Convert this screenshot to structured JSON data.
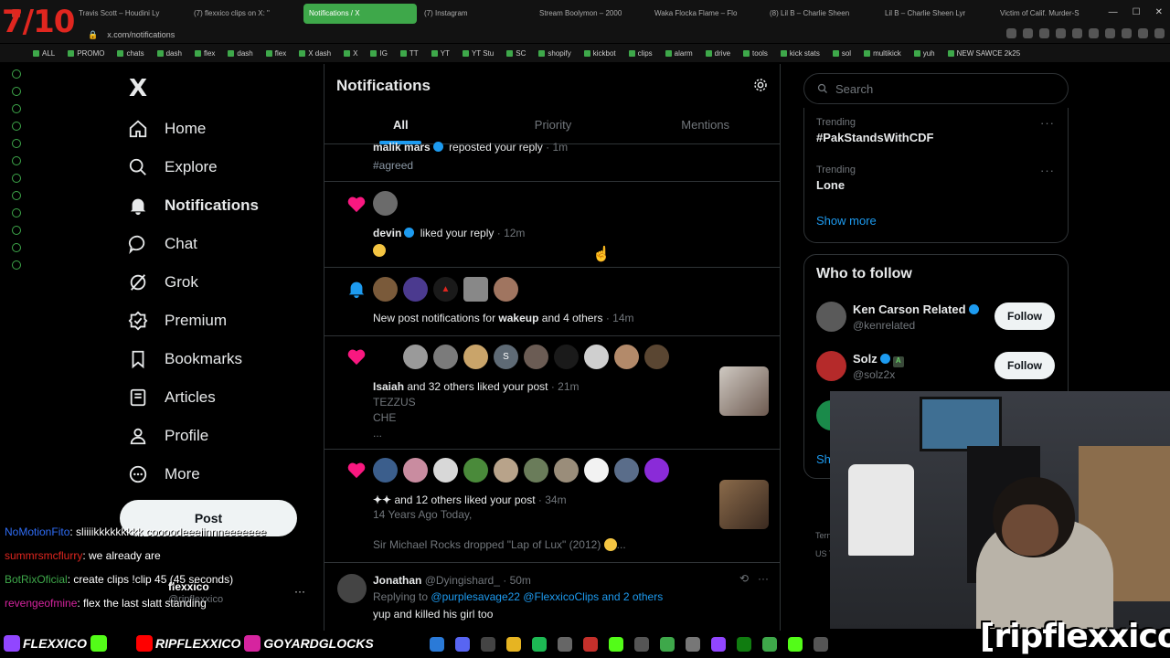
{
  "browser": {
    "tabs": [
      {
        "label": "Travis Scott – Houdini Ly",
        "color": "#c0392b"
      },
      {
        "label": "(7) flexxico clips on X: \"",
        "color": "#888888"
      },
      {
        "label": "Notifications / X",
        "color": "#ffffff",
        "active": true
      },
      {
        "label": "(7) Instagram",
        "color": "#d6249f"
      },
      {
        "label": "Stream Boolymon – 2000",
        "color": "#e74c3c"
      },
      {
        "label": "Waka Flocka Flame – Flo",
        "color": "#1e90ff"
      },
      {
        "label": "(8) Lil B – Charlie Sheen",
        "color": "#e53935"
      },
      {
        "label": "Lil B – Charlie Sheen Lyr",
        "color": "#333333"
      },
      {
        "label": "Victim of Calif. Murder-S",
        "color": "#c0392b"
      }
    ],
    "url": "x.com/notifications",
    "bookmarks": [
      "ALL",
      "PROMO",
      "chats",
      "dash",
      "flex",
      "dash",
      "flex",
      "X dash",
      "X",
      "IG",
      "TT",
      "YT",
      "YT Stu",
      "SC",
      "shopify",
      "kickbot",
      "clips",
      "alarm",
      "drive",
      "tools",
      "kick stats",
      "sol",
      "multikick",
      "yuh",
      "NEW SAWCE 2k25"
    ]
  },
  "nav": {
    "logo": "X",
    "items": [
      {
        "label": "Home",
        "icon": "home-icon"
      },
      {
        "label": "Explore",
        "icon": "search-icon"
      },
      {
        "label": "Notifications",
        "icon": "bell-icon"
      },
      {
        "label": "Chat",
        "icon": "chat-icon"
      },
      {
        "label": "Grok",
        "icon": "grok-icon"
      },
      {
        "label": "Premium",
        "icon": "premium-icon"
      },
      {
        "label": "Bookmarks",
        "icon": "bookmark-icon"
      },
      {
        "label": "Articles",
        "icon": "articles-icon"
      },
      {
        "label": "Profile",
        "icon": "profile-icon"
      },
      {
        "label": "More",
        "icon": "more-icon"
      }
    ],
    "post_label": "Post",
    "account_name": "flexxico",
    "account_handle": "@ripflexxico"
  },
  "main": {
    "title": "Notifications",
    "tabs": [
      "All",
      "Priority",
      "Mentions"
    ],
    "n0": {
      "name": "malik mars",
      "action": "reposted your reply",
      "time": "· 1m",
      "text": "#agreed"
    },
    "n1": {
      "name": "devin",
      "action": "liked your reply",
      "time": "· 12m"
    },
    "n2": {
      "prefix": "New post notifications for",
      "name": "wakeup",
      "suffix": "and 4 others",
      "time": "· 14m"
    },
    "n3": {
      "name": "Isaiah",
      "action": "and 32 others liked your post",
      "time": "· 21m",
      "line1": "TEZZUS",
      "line2": "CHE",
      "line3": "..."
    },
    "n4": {
      "name": "",
      "action": "and 12 others liked your post",
      "time": "· 34m",
      "line1": "14 Years Ago Today,",
      "line2": "Sir Michael Rocks dropped \"Lap of Lux\" (2012)",
      "line3": "..."
    },
    "n5": {
      "name": "Jonathan",
      "handle": "@Dyingishard_",
      "time": "· 50m",
      "replying": "Replying to",
      "mentions": "@purplesavage22 @FlexxicoClips and 2 others",
      "text": "yup and killed his girl too"
    }
  },
  "right": {
    "search_placeholder": "Search",
    "trends": [
      {
        "label": "Trending",
        "title": "#PakStandsWithCDF"
      },
      {
        "label": "Trending",
        "title": "Lone"
      }
    ],
    "show_more": "Show more",
    "wtf_title": "Who to follow",
    "follow": [
      {
        "name": "Ken Carson Related",
        "handle": "@kenrelated",
        "button": "Follow"
      },
      {
        "name": "Solz",
        "handle": "@solz2x",
        "button": "Follow"
      }
    ],
    "show_more2": "Sh",
    "terms1": "Tern",
    "terms2": "US T"
  },
  "stream": {
    "counter": "7/10",
    "brand": "[ripflexxico]",
    "chat": [
      {
        "user": "NoMotionFito",
        "color": "#2f6df6",
        "msg": ": sliiiikkkkkkkkk coooodeeeiinnneeeeeee"
      },
      {
        "user": "summrsmcflurry",
        "color": "#e0261f",
        "msg": ": we already are"
      },
      {
        "user": "BotRixOficial",
        "color": "#3ea84a",
        "msg": ": create clips !clip 45 (45 seconds)"
      },
      {
        "user": "revengeofmine",
        "color": "#d6249f",
        "msg": ": flex the last slatt standing"
      }
    ],
    "socials": [
      {
        "label": "FLEXXICO",
        "color": "#9146ff"
      },
      {
        "label": "",
        "color": "#53fc18"
      },
      {
        "label": "",
        "color": "#000000"
      },
      {
        "label": "RIPFLEXXICO",
        "color": "#ff0000"
      },
      {
        "label": "GOYARDGLOCKS",
        "color": "#d6249f"
      }
    ]
  }
}
